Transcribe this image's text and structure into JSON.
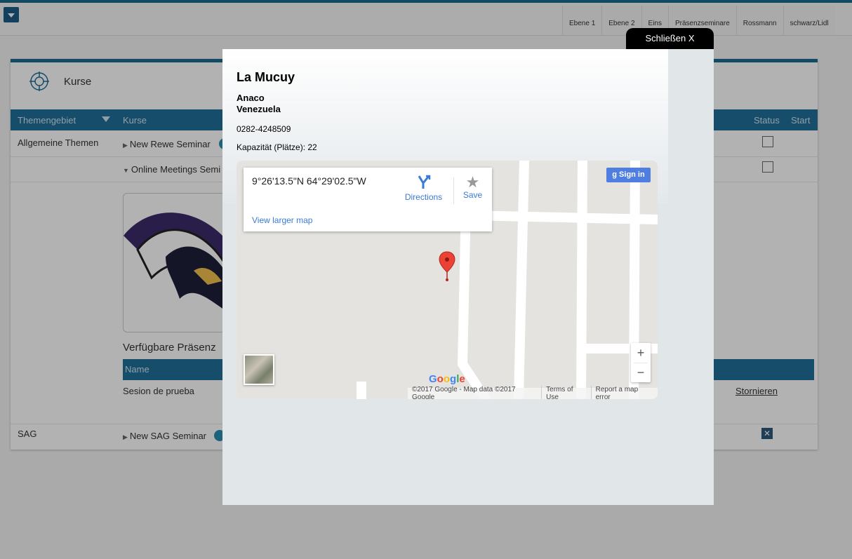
{
  "header": {
    "tabs": [
      "Ebene 1",
      "Ebene 2",
      "Eins",
      "Präsenzseminare",
      "Rossmann",
      "schwarz/Lidl"
    ]
  },
  "panel": {
    "title": "Kurse",
    "columns": {
      "themengebiet": "Themengebiet",
      "kurse": "Kurse",
      "status": "Status",
      "start": "Start"
    },
    "rows": [
      {
        "theme": "Allgemeine Themen",
        "course": "New Rewe Seminar"
      },
      {
        "theme": "",
        "course": "Online Meetings Semi"
      },
      {
        "theme": "SAG",
        "course": "New SAG Seminar"
      }
    ],
    "available_heading": "Verfügbare Präsenz",
    "sub_header_name": "Name",
    "session_name": "Sesion de prueba",
    "cancel_link": "Stornieren"
  },
  "modal": {
    "close_label": "Schließen X",
    "title": "La Mucuy",
    "city": "Anaco",
    "country": "Venezuela",
    "phone": "0282-4248509",
    "capacity": "Kapazität (Plätze): 22",
    "map": {
      "coordinates": "9°26'13.5\"N 64°29'02.5\"W",
      "directions": "Directions",
      "save": "Save",
      "view_larger": "View larger map",
      "sign_in": "Sign in",
      "zoom_in": "+",
      "zoom_out": "−",
      "google_logo": "Google",
      "copyright": "©2017 Google - Map data ©2017 Google",
      "terms": "Terms of Use",
      "report": "Report a map error"
    }
  },
  "colors": {
    "accent": "#1f6f98",
    "link": "#3a7bd5",
    "pin": "#ea4335"
  }
}
